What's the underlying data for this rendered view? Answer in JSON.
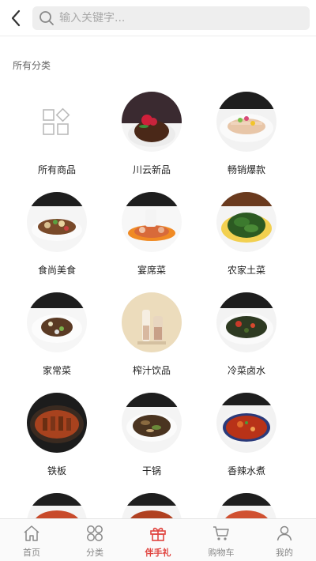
{
  "header": {
    "search_placeholder": "输入关键字..."
  },
  "section_title": "所有分类",
  "categories": [
    {
      "label": "所有商品",
      "image": "grid-icon"
    },
    {
      "label": "川云新品",
      "image": "dish-photo"
    },
    {
      "label": "畅销爆款",
      "image": "dish-photo"
    },
    {
      "label": "食尚美食",
      "image": "dish-photo"
    },
    {
      "label": "宴席菜",
      "image": "dish-photo"
    },
    {
      "label": "农家土菜",
      "image": "dish-photo"
    },
    {
      "label": "家常菜",
      "image": "dish-photo"
    },
    {
      "label": "榨汁饮品",
      "image": "drink-photo"
    },
    {
      "label": "冷菜卤水",
      "image": "dish-photo"
    },
    {
      "label": "铁板",
      "image": "dish-photo"
    },
    {
      "label": "干锅",
      "image": "dish-photo"
    },
    {
      "label": "香辣水煮",
      "image": "dish-photo"
    }
  ],
  "tabbar": {
    "items": [
      {
        "label": "首页",
        "icon": "home-icon"
      },
      {
        "label": "分类",
        "icon": "category-icon"
      },
      {
        "label": "伴手礼",
        "icon": "gift-icon",
        "active": true
      },
      {
        "label": "购物车",
        "icon": "cart-icon"
      },
      {
        "label": "我的",
        "icon": "user-icon"
      }
    ]
  },
  "colors": {
    "accent": "#e0443f",
    "inactive": "#888888"
  }
}
